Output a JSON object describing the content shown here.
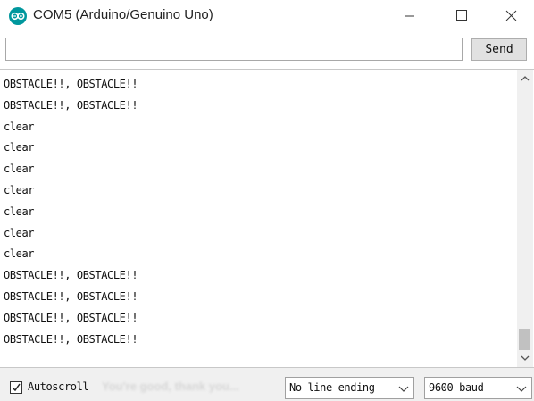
{
  "window": {
    "title": "COM5 (Arduino/Genuino Uno)",
    "icons": {
      "app": "arduino-logo-icon",
      "minimize": "minimize-icon",
      "maximize": "maximize-icon",
      "close": "close-icon"
    }
  },
  "toolbar": {
    "send_input_value": "",
    "send_label": "Send"
  },
  "serial_output": {
    "lines": [
      "OBSTACLE!!, OBSTACLE!!",
      "OBSTACLE!!, OBSTACLE!!",
      "clear",
      "clear",
      "clear",
      "clear",
      "clear",
      "clear",
      "clear",
      "OBSTACLE!!, OBSTACLE!!",
      "OBSTACLE!!, OBSTACLE!!",
      "OBSTACLE!!, OBSTACLE!!",
      "OBSTACLE!!, OBSTACLE!!"
    ],
    "scroll_position": 1.0
  },
  "footer": {
    "autoscroll_label": "Autoscroll",
    "autoscroll_checked": true,
    "line_ending_selected": "No line ending",
    "baud_selected": "9600 baud"
  },
  "colors": {
    "app_icon": "#00979d",
    "status_bar": "#f0f0f0"
  }
}
